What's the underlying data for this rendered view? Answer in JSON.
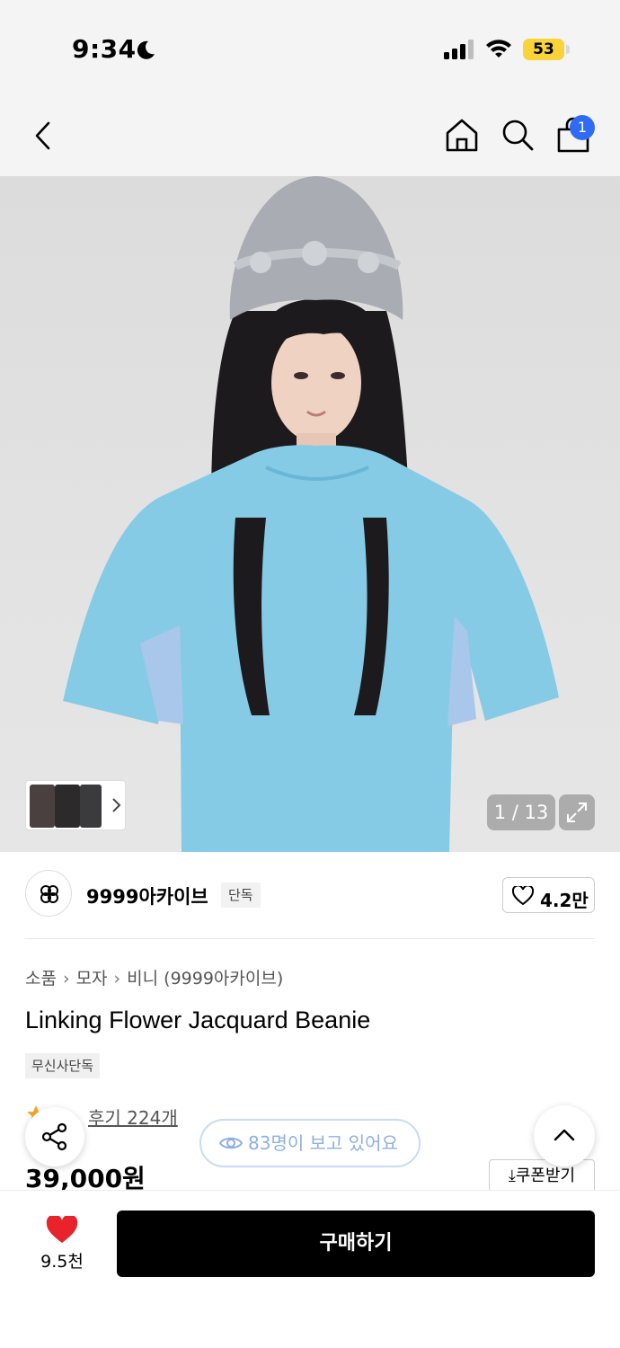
{
  "status_bar": {
    "time": "9:34",
    "battery": "53"
  },
  "nav": {
    "cart_count": "1"
  },
  "gallery": {
    "counter": "1 / 13"
  },
  "brand": {
    "name": "9999아카이브",
    "tag": "단독",
    "likes": "4.2만"
  },
  "breadcrumb": {
    "items": [
      "소품",
      "모자",
      "비니 (9999아카이브)"
    ]
  },
  "product": {
    "title": "Linking Flower Jacquard Beanie",
    "tag": "무신사단독",
    "reviews": "후기 224개",
    "price": "39,000원",
    "coupon_label": "쿠폰받기"
  },
  "floating": {
    "viewers": "83명이 보고 있어요"
  },
  "bottom_bar": {
    "likes": "9.5천",
    "buy_label": "구매하기"
  },
  "colors": {
    "accent_blue": "#2f6cf5",
    "like_red": "#e8232c",
    "buy_black": "#000000"
  }
}
